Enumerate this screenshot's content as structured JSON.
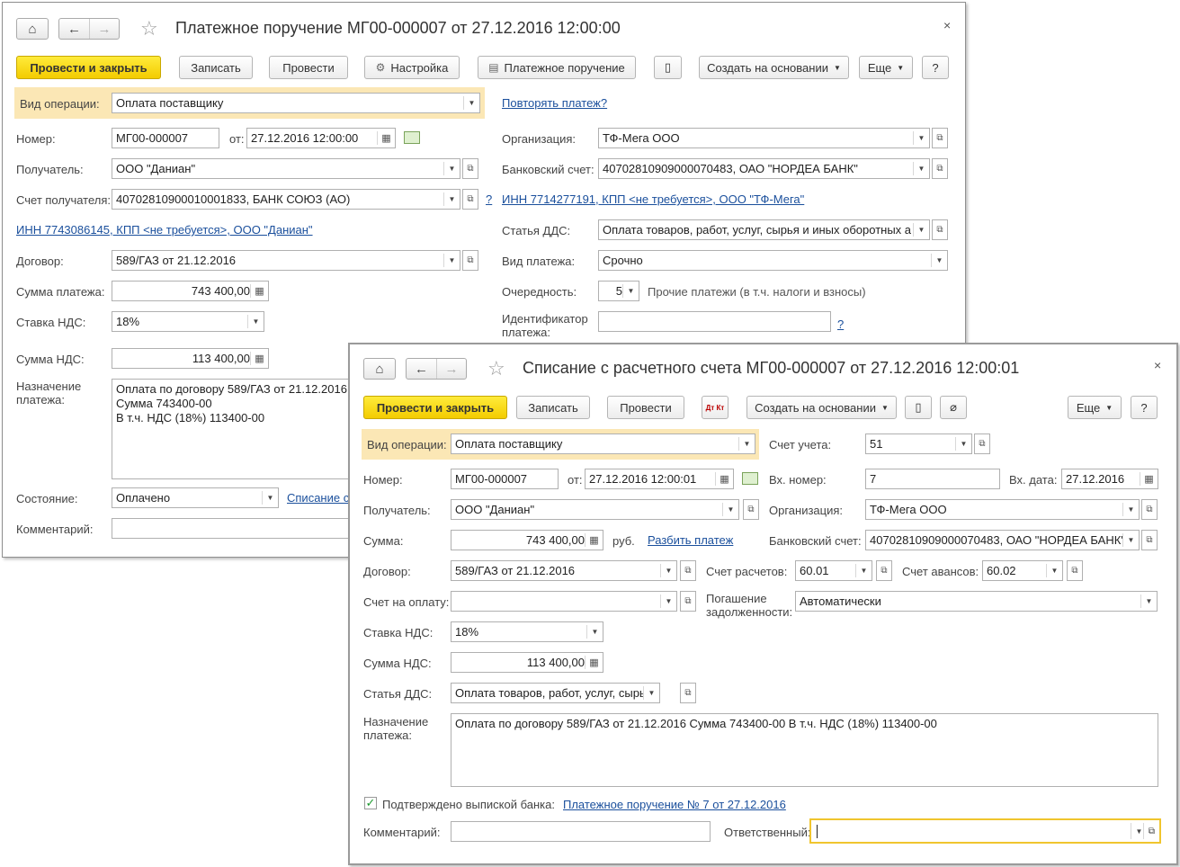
{
  "w1": {
    "title": "Платежное поручение МГ00-000007 от 27.12.2016 12:00:00",
    "close": "×",
    "toolbar": {
      "post_close": "Провести и закрыть",
      "save": "Записать",
      "post": "Провести",
      "settings": "Настройка",
      "print": "Платежное поручение",
      "create_based": "Создать на основании",
      "more": "Еще",
      "help": "?"
    },
    "op_type": {
      "label": "Вид операции:",
      "value": "Оплата поставщику"
    },
    "repeat_link": "Повторять платеж?",
    "number": {
      "label": "Номер:",
      "value": "МГ00-000007",
      "from_label": "от:",
      "date": "27.12.2016 12:00:00"
    },
    "org": {
      "label": "Организация:",
      "value": "ТФ-Мега ООО"
    },
    "recipient": {
      "label": "Получатель:",
      "value": "ООО \"Даниан\""
    },
    "bank_acc": {
      "label": "Банковский счет:",
      "value": "40702810909000070483, ОАО \"НОРДЕА БАНК\""
    },
    "recipient_acc": {
      "label": "Счет получателя:",
      "value": "40702810900010001833, БАНК СОЮЗ (АО)",
      "q": "?"
    },
    "inn_org_link": "ИНН 7714277191, КПП <не требуется>, ООО \"ТФ-Мега\"",
    "inn_rec_link": "ИНН 7743086145, КПП <не требуется>, ООО \"Даниан\"",
    "dds": {
      "label": "Статья ДДС:",
      "value": "Оплата товаров, работ, услуг, сырья и иных оборотных а"
    },
    "contract": {
      "label": "Договор:",
      "value": "589/ГАЗ от 21.12.2016"
    },
    "pay_kind": {
      "label": "Вид платежа:",
      "value": "Срочно"
    },
    "amount": {
      "label": "Сумма платежа:",
      "value": "743 400,00"
    },
    "priority": {
      "label": "Очередность:",
      "value": "5",
      "desc": "Прочие платежи (в т.ч. налоги и взносы)"
    },
    "vat_rate": {
      "label": "Ставка НДС:",
      "value": "18%"
    },
    "pay_id": {
      "label1": "Идентификатор",
      "label2": "платежа:",
      "value": "",
      "q": "?"
    },
    "vat_sum": {
      "label": "Сумма НДС:",
      "value": "113 400,00"
    },
    "purpose": {
      "label1": "Назначение",
      "label2": "платежа:",
      "lines": [
        "Оплата по договору 589/ГАЗ от 21.12.2016",
        "Сумма 743400-00",
        "В т.ч. НДС  (18%) 113400-00"
      ]
    },
    "state": {
      "label": "Состояние:",
      "value": "Оплачено",
      "link": "Списание с"
    },
    "comment": {
      "label": "Комментарий:",
      "value": ""
    }
  },
  "w2": {
    "title": "Списание с расчетного счета МГ00-000007 от 27.12.2016 12:00:01",
    "close": "×",
    "toolbar": {
      "post_close": "Провести и закрыть",
      "save": "Записать",
      "post": "Провести",
      "dtkt": "Дт Кт",
      "create_based": "Создать на основании",
      "more": "Еще",
      "help": "?"
    },
    "op_type": {
      "label": "Вид операции:",
      "value": "Оплата поставщику"
    },
    "account": {
      "label": "Счет учета:",
      "value": "51"
    },
    "number": {
      "label": "Номер:",
      "value": "МГ00-000007",
      "from_label": "от:",
      "date": "27.12.2016 12:00:01"
    },
    "in_number": {
      "label": "Вх. номер:",
      "value": "7"
    },
    "in_date": {
      "label": "Вх. дата:",
      "value": "27.12.2016"
    },
    "recipient": {
      "label": "Получатель:",
      "value": "ООО \"Даниан\""
    },
    "org": {
      "label": "Организация:",
      "value": "ТФ-Мега ООО"
    },
    "sum": {
      "label": "Сумма:",
      "value": "743 400,00",
      "currency": "руб.",
      "split_link": "Разбить платеж"
    },
    "bank_acc": {
      "label": "Банковский счет:",
      "value": "40702810909000070483, ОАО \"НОРДЕА БАНК\""
    },
    "contract": {
      "label": "Договор:",
      "value": "589/ГАЗ от 21.12.2016"
    },
    "settle_acc": {
      "label": "Счет расчетов:",
      "value": "60.01"
    },
    "advance_acc": {
      "label": "Счет авансов:",
      "value": "60.02"
    },
    "invoice": {
      "label": "Счет на оплату:",
      "value": ""
    },
    "repayment": {
      "label1": "Погашение",
      "label2": "задолженности:",
      "value": "Автоматически"
    },
    "vat_rate": {
      "label": "Ставка НДС:",
      "value": "18%"
    },
    "vat_sum": {
      "label": "Сумма НДС:",
      "value": "113 400,00"
    },
    "dds": {
      "label": "Статья ДДС:",
      "value": "Оплата товаров, работ, услуг, сырья и иных оборотных активов"
    },
    "purpose": {
      "label1": "Назначение",
      "label2": "платежа:",
      "value": "Оплата по договору 589/ГАЗ от 21.12.2016 Сумма 743400-00 В т.ч. НДС  (18%) 113400-00"
    },
    "confirmed": {
      "label": "Подтверждено выпиской банка:",
      "link": "Платежное поручение № 7 от 27.12.2016",
      "checked": true
    },
    "comment": {
      "label": "Комментарий:",
      "value": ""
    },
    "responsible": {
      "label": "Ответственный:",
      "value": ""
    }
  }
}
